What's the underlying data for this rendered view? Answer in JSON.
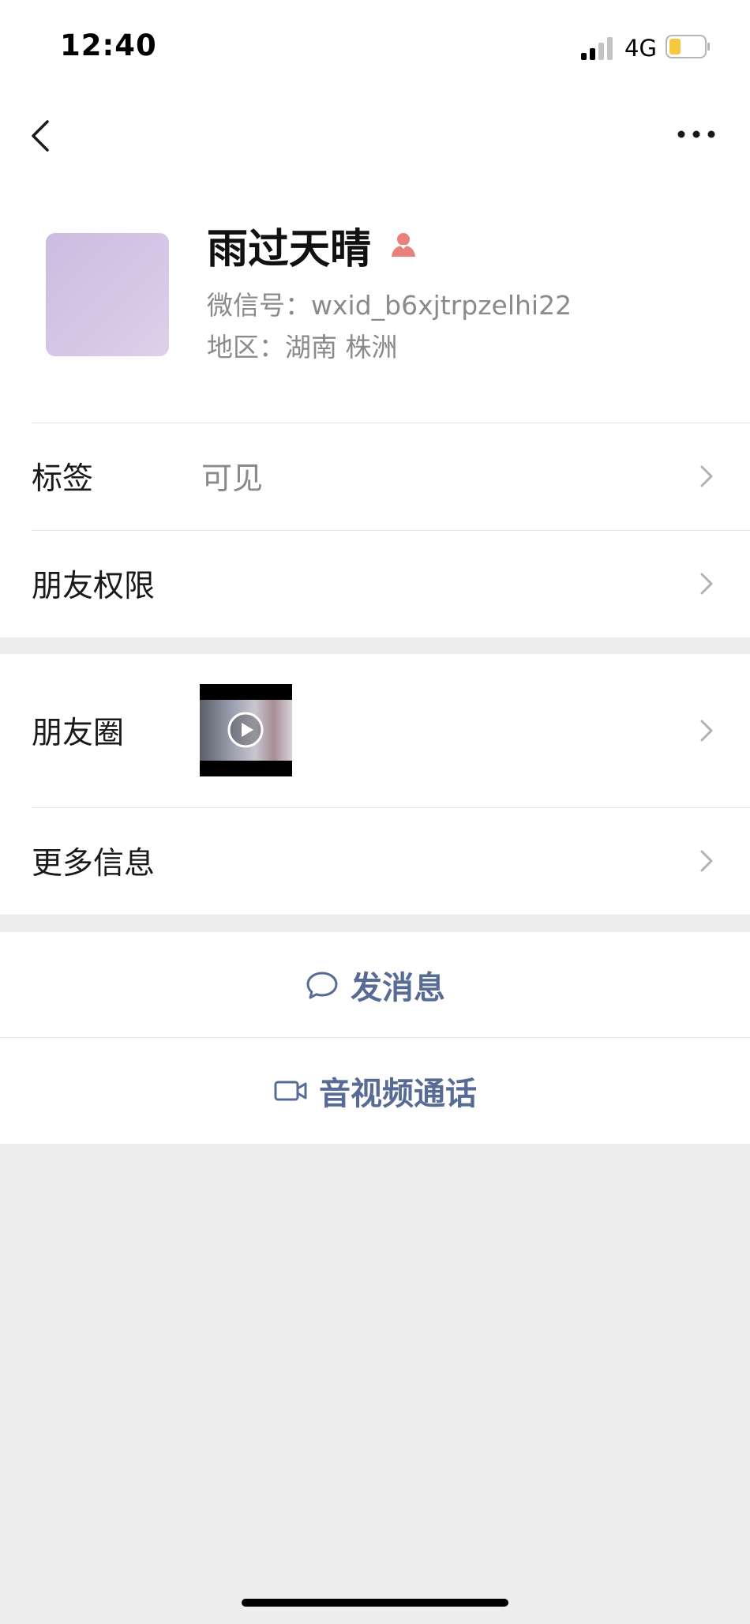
{
  "status_bar": {
    "time": "12:40",
    "network": "4G",
    "battery_level_fraction": 0.25,
    "battery_color": "#f6c73f"
  },
  "nav": {
    "back_icon": "chevron-left-icon",
    "more_icon": "ellipsis-icon"
  },
  "profile": {
    "name": "雨过天晴",
    "gender_icon": "female-user-icon",
    "gender_color": "#e8807b",
    "wechat_id": "微信号：wxid_b6xjtrpzelhi22",
    "region": "地区：湖南 株洲"
  },
  "rows": {
    "tags": {
      "label": "标签",
      "value": "可见"
    },
    "friend_permissions": {
      "label": "朋友权限"
    },
    "moments": {
      "label": "朋友圈"
    },
    "more_info": {
      "label": "更多信息"
    }
  },
  "actions": {
    "send_message": {
      "label": "发消息",
      "icon": "chat-bubble-icon"
    },
    "video_call": {
      "label": "音视频通话",
      "icon": "video-camera-icon"
    }
  },
  "colors": {
    "link": "#576b95",
    "background": "#ededed"
  }
}
